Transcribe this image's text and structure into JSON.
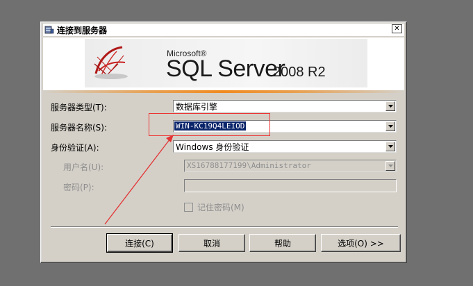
{
  "dialog": {
    "title": "连接到服务器",
    "close_glyph": "✕"
  },
  "banner": {
    "brand_small": "Microsoft®",
    "product": "SQL Server",
    "version": "2008 R2"
  },
  "form": {
    "server_type_label": "服务器类型(T):",
    "server_type_value": "数据库引擎",
    "server_name_label": "服务器名称(S):",
    "server_name_value": "WIN-KC19Q4LEIOD",
    "auth_label": "身份验证(A):",
    "auth_value": "Windows 身份验证",
    "username_label": "用户名(U):",
    "username_value": "XS16788177199\\Administrator",
    "password_label": "密码(P):",
    "password_value": "",
    "remember_label": "记住密码(M)"
  },
  "buttons": {
    "connect": "连接(C)",
    "cancel": "取消",
    "help": "帮助",
    "options": "选项(O) >>"
  },
  "annotation": {
    "color": "#e33333"
  },
  "colors": {
    "dialog_bg": "#d4d0c8",
    "desktop_bg": "#707070",
    "selection": "#0a246a"
  }
}
